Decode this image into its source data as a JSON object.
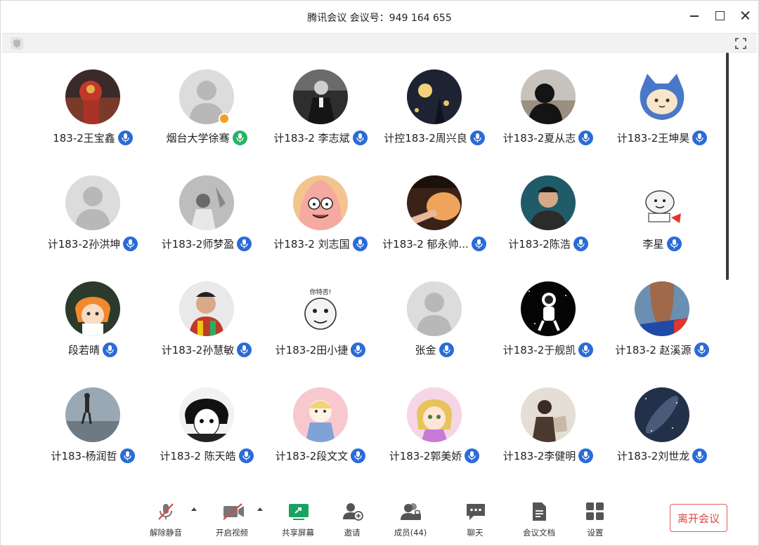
{
  "window": {
    "title": "腾讯会议 会议号：949 164 655"
  },
  "participants": [
    {
      "name": "183-2王宝鑫",
      "mic": "blue",
      "avatar": "photo-red"
    },
    {
      "name": "烟台大学徐骞",
      "mic": "green",
      "avatar": "default",
      "host": true
    },
    {
      "name": "计183-2 李志斌",
      "mic": "blue",
      "avatar": "photo-bw"
    },
    {
      "name": "计控183-2周兴良",
      "mic": "blue",
      "avatar": "photo-night"
    },
    {
      "name": "计183-2夏从志",
      "mic": "blue",
      "avatar": "photo-silhouette"
    },
    {
      "name": "计183-2王坤昊",
      "mic": "blue",
      "avatar": "cat"
    },
    {
      "name": "计183-2孙洪坤",
      "mic": "blue",
      "avatar": "default"
    },
    {
      "name": "计183-2师梦盈",
      "mic": "blue",
      "avatar": "photo-grey"
    },
    {
      "name": "计183-2 刘志国",
      "mic": "blue",
      "avatar": "cartoon-star"
    },
    {
      "name": "计183-2 郁永帅...",
      "mic": "blue",
      "avatar": "photo-warm"
    },
    {
      "name": "计183-2陈浩",
      "mic": "blue",
      "avatar": "photo-teal"
    },
    {
      "name": "李星",
      "mic": "blue",
      "avatar": "meme"
    },
    {
      "name": "段若晴",
      "mic": "blue",
      "avatar": "anime-orange"
    },
    {
      "name": "计183-2孙慧敏",
      "mic": "blue",
      "avatar": "photo-bright"
    },
    {
      "name": "计183-2田小捷",
      "mic": "blue",
      "avatar": "meme-text"
    },
    {
      "name": "张金",
      "mic": "blue",
      "avatar": "default"
    },
    {
      "name": "计183-2于舰凯",
      "mic": "blue",
      "avatar": "astronaut"
    },
    {
      "name": "计183-2 赵溪源",
      "mic": "blue",
      "avatar": "photo-hair"
    },
    {
      "name": "计183-杨润哲",
      "mic": "blue",
      "avatar": "photo-sea"
    },
    {
      "name": "计183-2 陈天皓",
      "mic": "blue",
      "avatar": "anime-bw"
    },
    {
      "name": "计183-2段文文",
      "mic": "blue",
      "avatar": "cartoon-girl"
    },
    {
      "name": "计183-2郭美娇",
      "mic": "blue",
      "avatar": "anime-pink"
    },
    {
      "name": "计183-2李健明",
      "mic": "blue",
      "avatar": "photo-sketch"
    },
    {
      "name": "计183-2刘世龙",
      "mic": "blue",
      "avatar": "galaxy"
    }
  ],
  "meme_text": "你特否!",
  "toolbar": {
    "mute_label": "解除静音",
    "video_label": "开启视频",
    "share_label": "共享屏幕",
    "invite_label": "邀请",
    "members_label": "成员(44)",
    "chat_label": "聊天",
    "docs_label": "会议文档",
    "settings_label": "设置",
    "leave_label": "离开会议"
  },
  "colors": {
    "mic_blue": "#2a6bd8",
    "mic_green": "#28b463",
    "share_green": "#1aa260",
    "leave_red": "#e04545"
  }
}
